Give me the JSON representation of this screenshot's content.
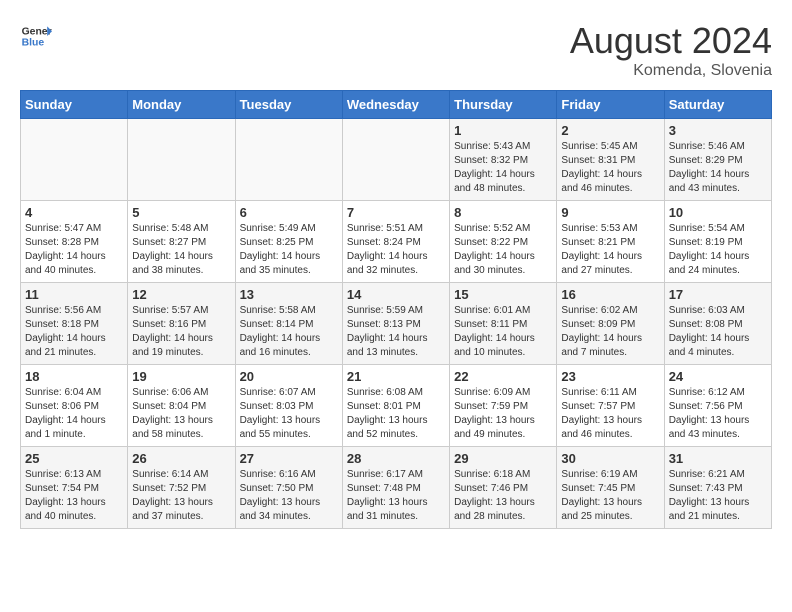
{
  "header": {
    "logo_general": "General",
    "logo_blue": "Blue",
    "month_year": "August 2024",
    "location": "Komenda, Slovenia"
  },
  "days_of_week": [
    "Sunday",
    "Monday",
    "Tuesday",
    "Wednesday",
    "Thursday",
    "Friday",
    "Saturday"
  ],
  "weeks": [
    [
      {
        "day": "",
        "info": ""
      },
      {
        "day": "",
        "info": ""
      },
      {
        "day": "",
        "info": ""
      },
      {
        "day": "",
        "info": ""
      },
      {
        "day": "1",
        "info": "Sunrise: 5:43 AM\nSunset: 8:32 PM\nDaylight: 14 hours\nand 48 minutes."
      },
      {
        "day": "2",
        "info": "Sunrise: 5:45 AM\nSunset: 8:31 PM\nDaylight: 14 hours\nand 46 minutes."
      },
      {
        "day": "3",
        "info": "Sunrise: 5:46 AM\nSunset: 8:29 PM\nDaylight: 14 hours\nand 43 minutes."
      }
    ],
    [
      {
        "day": "4",
        "info": "Sunrise: 5:47 AM\nSunset: 8:28 PM\nDaylight: 14 hours\nand 40 minutes."
      },
      {
        "day": "5",
        "info": "Sunrise: 5:48 AM\nSunset: 8:27 PM\nDaylight: 14 hours\nand 38 minutes."
      },
      {
        "day": "6",
        "info": "Sunrise: 5:49 AM\nSunset: 8:25 PM\nDaylight: 14 hours\nand 35 minutes."
      },
      {
        "day": "7",
        "info": "Sunrise: 5:51 AM\nSunset: 8:24 PM\nDaylight: 14 hours\nand 32 minutes."
      },
      {
        "day": "8",
        "info": "Sunrise: 5:52 AM\nSunset: 8:22 PM\nDaylight: 14 hours\nand 30 minutes."
      },
      {
        "day": "9",
        "info": "Sunrise: 5:53 AM\nSunset: 8:21 PM\nDaylight: 14 hours\nand 27 minutes."
      },
      {
        "day": "10",
        "info": "Sunrise: 5:54 AM\nSunset: 8:19 PM\nDaylight: 14 hours\nand 24 minutes."
      }
    ],
    [
      {
        "day": "11",
        "info": "Sunrise: 5:56 AM\nSunset: 8:18 PM\nDaylight: 14 hours\nand 21 minutes."
      },
      {
        "day": "12",
        "info": "Sunrise: 5:57 AM\nSunset: 8:16 PM\nDaylight: 14 hours\nand 19 minutes."
      },
      {
        "day": "13",
        "info": "Sunrise: 5:58 AM\nSunset: 8:14 PM\nDaylight: 14 hours\nand 16 minutes."
      },
      {
        "day": "14",
        "info": "Sunrise: 5:59 AM\nSunset: 8:13 PM\nDaylight: 14 hours\nand 13 minutes."
      },
      {
        "day": "15",
        "info": "Sunrise: 6:01 AM\nSunset: 8:11 PM\nDaylight: 14 hours\nand 10 minutes."
      },
      {
        "day": "16",
        "info": "Sunrise: 6:02 AM\nSunset: 8:09 PM\nDaylight: 14 hours\nand 7 minutes."
      },
      {
        "day": "17",
        "info": "Sunrise: 6:03 AM\nSunset: 8:08 PM\nDaylight: 14 hours\nand 4 minutes."
      }
    ],
    [
      {
        "day": "18",
        "info": "Sunrise: 6:04 AM\nSunset: 8:06 PM\nDaylight: 14 hours\nand 1 minute."
      },
      {
        "day": "19",
        "info": "Sunrise: 6:06 AM\nSunset: 8:04 PM\nDaylight: 13 hours\nand 58 minutes."
      },
      {
        "day": "20",
        "info": "Sunrise: 6:07 AM\nSunset: 8:03 PM\nDaylight: 13 hours\nand 55 minutes."
      },
      {
        "day": "21",
        "info": "Sunrise: 6:08 AM\nSunset: 8:01 PM\nDaylight: 13 hours\nand 52 minutes."
      },
      {
        "day": "22",
        "info": "Sunrise: 6:09 AM\nSunset: 7:59 PM\nDaylight: 13 hours\nand 49 minutes."
      },
      {
        "day": "23",
        "info": "Sunrise: 6:11 AM\nSunset: 7:57 PM\nDaylight: 13 hours\nand 46 minutes."
      },
      {
        "day": "24",
        "info": "Sunrise: 6:12 AM\nSunset: 7:56 PM\nDaylight: 13 hours\nand 43 minutes."
      }
    ],
    [
      {
        "day": "25",
        "info": "Sunrise: 6:13 AM\nSunset: 7:54 PM\nDaylight: 13 hours\nand 40 minutes."
      },
      {
        "day": "26",
        "info": "Sunrise: 6:14 AM\nSunset: 7:52 PM\nDaylight: 13 hours\nand 37 minutes."
      },
      {
        "day": "27",
        "info": "Sunrise: 6:16 AM\nSunset: 7:50 PM\nDaylight: 13 hours\nand 34 minutes."
      },
      {
        "day": "28",
        "info": "Sunrise: 6:17 AM\nSunset: 7:48 PM\nDaylight: 13 hours\nand 31 minutes."
      },
      {
        "day": "29",
        "info": "Sunrise: 6:18 AM\nSunset: 7:46 PM\nDaylight: 13 hours\nand 28 minutes."
      },
      {
        "day": "30",
        "info": "Sunrise: 6:19 AM\nSunset: 7:45 PM\nDaylight: 13 hours\nand 25 minutes."
      },
      {
        "day": "31",
        "info": "Sunrise: 6:21 AM\nSunset: 7:43 PM\nDaylight: 13 hours\nand 21 minutes."
      }
    ]
  ]
}
